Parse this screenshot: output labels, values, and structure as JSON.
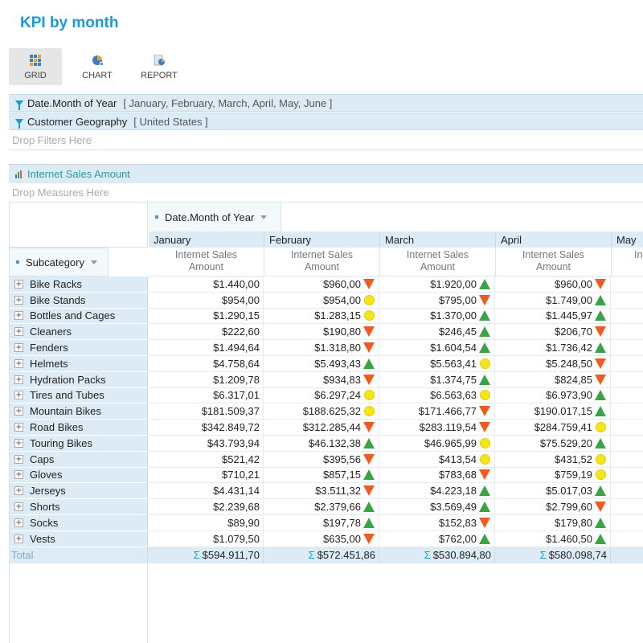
{
  "title": "KPI by month",
  "toolbar": {
    "grid": "GRID",
    "chart": "CHART",
    "report": "REPORT"
  },
  "filters": [
    {
      "field": "Date.Month of Year",
      "members": "[ January, February, March, April, May, June ]"
    },
    {
      "field": "Customer Geography",
      "members": "[ United States ]"
    }
  ],
  "drop_filters": "Drop Filters Here",
  "measure": "Internet Sales Amount",
  "drop_measures": "Drop Measures Here",
  "column_field": "Date.Month of Year",
  "row_field": "Subcategory",
  "months": [
    "January",
    "February",
    "March",
    "April",
    "May"
  ],
  "measure_header_line1": "Internet Sales",
  "measure_header_line2": "Amount",
  "measure_header_partial": "In",
  "colors": {
    "up": "#3aa346",
    "down": "#f05a1e",
    "neutral": "#f5e61a",
    "accent": "#1a9ad6"
  },
  "rows": [
    {
      "label": "Bike Racks",
      "jan": "$1.440,00",
      "feb": "$960,00",
      "feb_kpi": "down",
      "mar": "$1.920,00",
      "mar_kpi": "up",
      "apr": "$960,00",
      "apr_kpi": "down"
    },
    {
      "label": "Bike Stands",
      "jan": "$954,00",
      "feb": "$954,00",
      "feb_kpi": "neutral",
      "mar": "$795,00",
      "mar_kpi": "down",
      "apr": "$1.749,00",
      "apr_kpi": "up"
    },
    {
      "label": "Bottles and Cages",
      "jan": "$1.290,15",
      "feb": "$1.283,15",
      "feb_kpi": "neutral",
      "mar": "$1.370,00",
      "mar_kpi": "up",
      "apr": "$1.445,97",
      "apr_kpi": "up"
    },
    {
      "label": "Cleaners",
      "jan": "$222,60",
      "feb": "$190,80",
      "feb_kpi": "down",
      "mar": "$246,45",
      "mar_kpi": "up",
      "apr": "$206,70",
      "apr_kpi": "down"
    },
    {
      "label": "Fenders",
      "jan": "$1.494,64",
      "feb": "$1.318,80",
      "feb_kpi": "down",
      "mar": "$1.604,54",
      "mar_kpi": "up",
      "apr": "$1.736,42",
      "apr_kpi": "up"
    },
    {
      "label": "Helmets",
      "jan": "$4.758,64",
      "feb": "$5.493,43",
      "feb_kpi": "up",
      "mar": "$5.563,41",
      "mar_kpi": "neutral",
      "apr": "$5.248,50",
      "apr_kpi": "down"
    },
    {
      "label": "Hydration Packs",
      "jan": "$1.209,78",
      "feb": "$934,83",
      "feb_kpi": "down",
      "mar": "$1.374,75",
      "mar_kpi": "up",
      "apr": "$824,85",
      "apr_kpi": "down"
    },
    {
      "label": "Tires and Tubes",
      "jan": "$6.317,01",
      "feb": "$6.297,24",
      "feb_kpi": "neutral",
      "mar": "$6.563,63",
      "mar_kpi": "neutral",
      "apr": "$6.973,90",
      "apr_kpi": "up"
    },
    {
      "label": "Mountain Bikes",
      "jan": "$181.509,37",
      "feb": "$188.625,32",
      "feb_kpi": "neutral",
      "mar": "$171.466,77",
      "mar_kpi": "down",
      "apr": "$190.017,15",
      "apr_kpi": "up"
    },
    {
      "label": "Road Bikes",
      "jan": "$342.849,72",
      "feb": "$312.285,44",
      "feb_kpi": "down",
      "mar": "$283.119,54",
      "mar_kpi": "down",
      "apr": "$284.759,41",
      "apr_kpi": "neutral"
    },
    {
      "label": "Touring Bikes",
      "jan": "$43.793,94",
      "feb": "$46.132,38",
      "feb_kpi": "up",
      "mar": "$46.965,99",
      "mar_kpi": "neutral",
      "apr": "$75.529,20",
      "apr_kpi": "up"
    },
    {
      "label": "Caps",
      "jan": "$521,42",
      "feb": "$395,56",
      "feb_kpi": "down",
      "mar": "$413,54",
      "mar_kpi": "neutral",
      "apr": "$431,52",
      "apr_kpi": "neutral"
    },
    {
      "label": "Gloves",
      "jan": "$710,21",
      "feb": "$857,15",
      "feb_kpi": "up",
      "mar": "$783,68",
      "mar_kpi": "down",
      "apr": "$759,19",
      "apr_kpi": "neutral"
    },
    {
      "label": "Jerseys",
      "jan": "$4.431,14",
      "feb": "$3.511,32",
      "feb_kpi": "down",
      "mar": "$4.223,18",
      "mar_kpi": "up",
      "apr": "$5.017,03",
      "apr_kpi": "up"
    },
    {
      "label": "Shorts",
      "jan": "$2.239,68",
      "feb": "$2.379,66",
      "feb_kpi": "up",
      "mar": "$3.569,49",
      "mar_kpi": "up",
      "apr": "$2.799,60",
      "apr_kpi": "down"
    },
    {
      "label": "Socks",
      "jan": "$89,90",
      "feb": "$197,78",
      "feb_kpi": "up",
      "mar": "$152,83",
      "mar_kpi": "down",
      "apr": "$179,80",
      "apr_kpi": "up"
    },
    {
      "label": "Vests",
      "jan": "$1.079,50",
      "feb": "$635,00",
      "feb_kpi": "down",
      "mar": "$762,00",
      "mar_kpi": "up",
      "apr": "$1.460,50",
      "apr_kpi": "up"
    }
  ],
  "total": {
    "label": "Total",
    "sigma": "Σ",
    "jan": "$594.911,70",
    "feb": "$572.451,86",
    "mar": "$530.894,80",
    "apr": "$580.098,74"
  }
}
